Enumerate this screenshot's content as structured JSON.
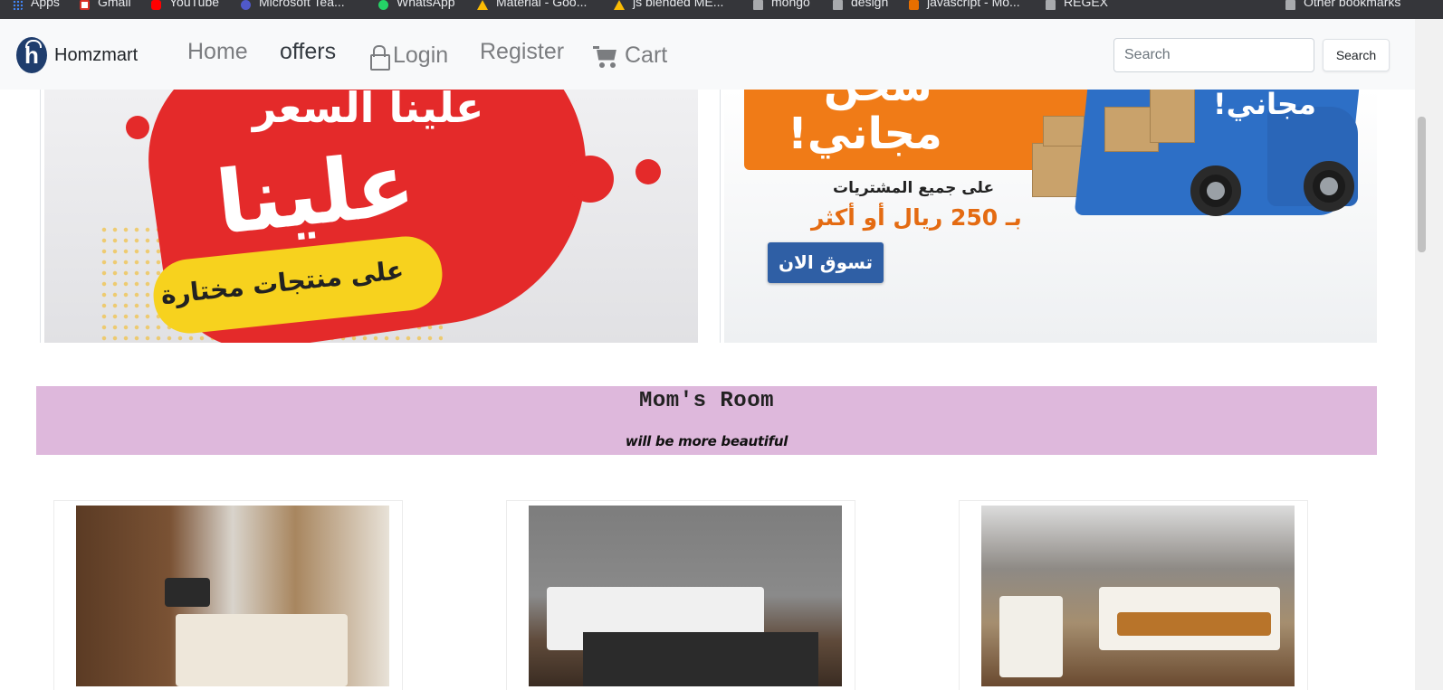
{
  "bookmarks": [
    {
      "label": "Apps",
      "icon": "apps-grid-icon"
    },
    {
      "label": "Gmail",
      "icon": "gmail-icon"
    },
    {
      "label": "YouTube",
      "icon": "youtube-icon"
    },
    {
      "label": "Microsoft Tea...",
      "icon": "teams-icon"
    },
    {
      "label": "WhatsApp",
      "icon": "whatsapp-icon"
    },
    {
      "label": "Material - Goo...",
      "icon": "drive-icon"
    },
    {
      "label": "js blended ME...",
      "icon": "drive-icon"
    },
    {
      "label": "mongo",
      "icon": "folder-icon"
    },
    {
      "label": "design",
      "icon": "folder-icon"
    },
    {
      "label": "javascript - Mo...",
      "icon": "java-icon"
    },
    {
      "label": "REGEX",
      "icon": "folder-icon"
    }
  ],
  "other_bookmarks": "Other bookmarks",
  "navbar": {
    "brand": "Homzmart",
    "links": {
      "home": "Home",
      "offers": "offers",
      "login": "Login",
      "register": "Register",
      "cart": "Cart"
    },
    "search": {
      "placeholder": "Search",
      "value": "",
      "button": "Search"
    }
  },
  "banners": {
    "left": {
      "headline_top": "علينا السعر",
      "headline_main": "علينا",
      "subline": "على منتجات مختارة"
    },
    "right": {
      "headline_top": "شحن",
      "headline_main": "مجاني!",
      "truck_text": "مجاني!",
      "line1": "على جميع المشتريات",
      "line2": "بـ 250 ريال أو أكثر",
      "button": "تسوق الان"
    }
  },
  "section": {
    "title": "Mom's Room",
    "subtitle": "will be more beautiful"
  },
  "colors": {
    "bookmarks_bg": "#35363a",
    "navbar_bg": "#f8f9fa",
    "section_band": "#deb8dc",
    "brand_logo": "#1f3d6d"
  }
}
